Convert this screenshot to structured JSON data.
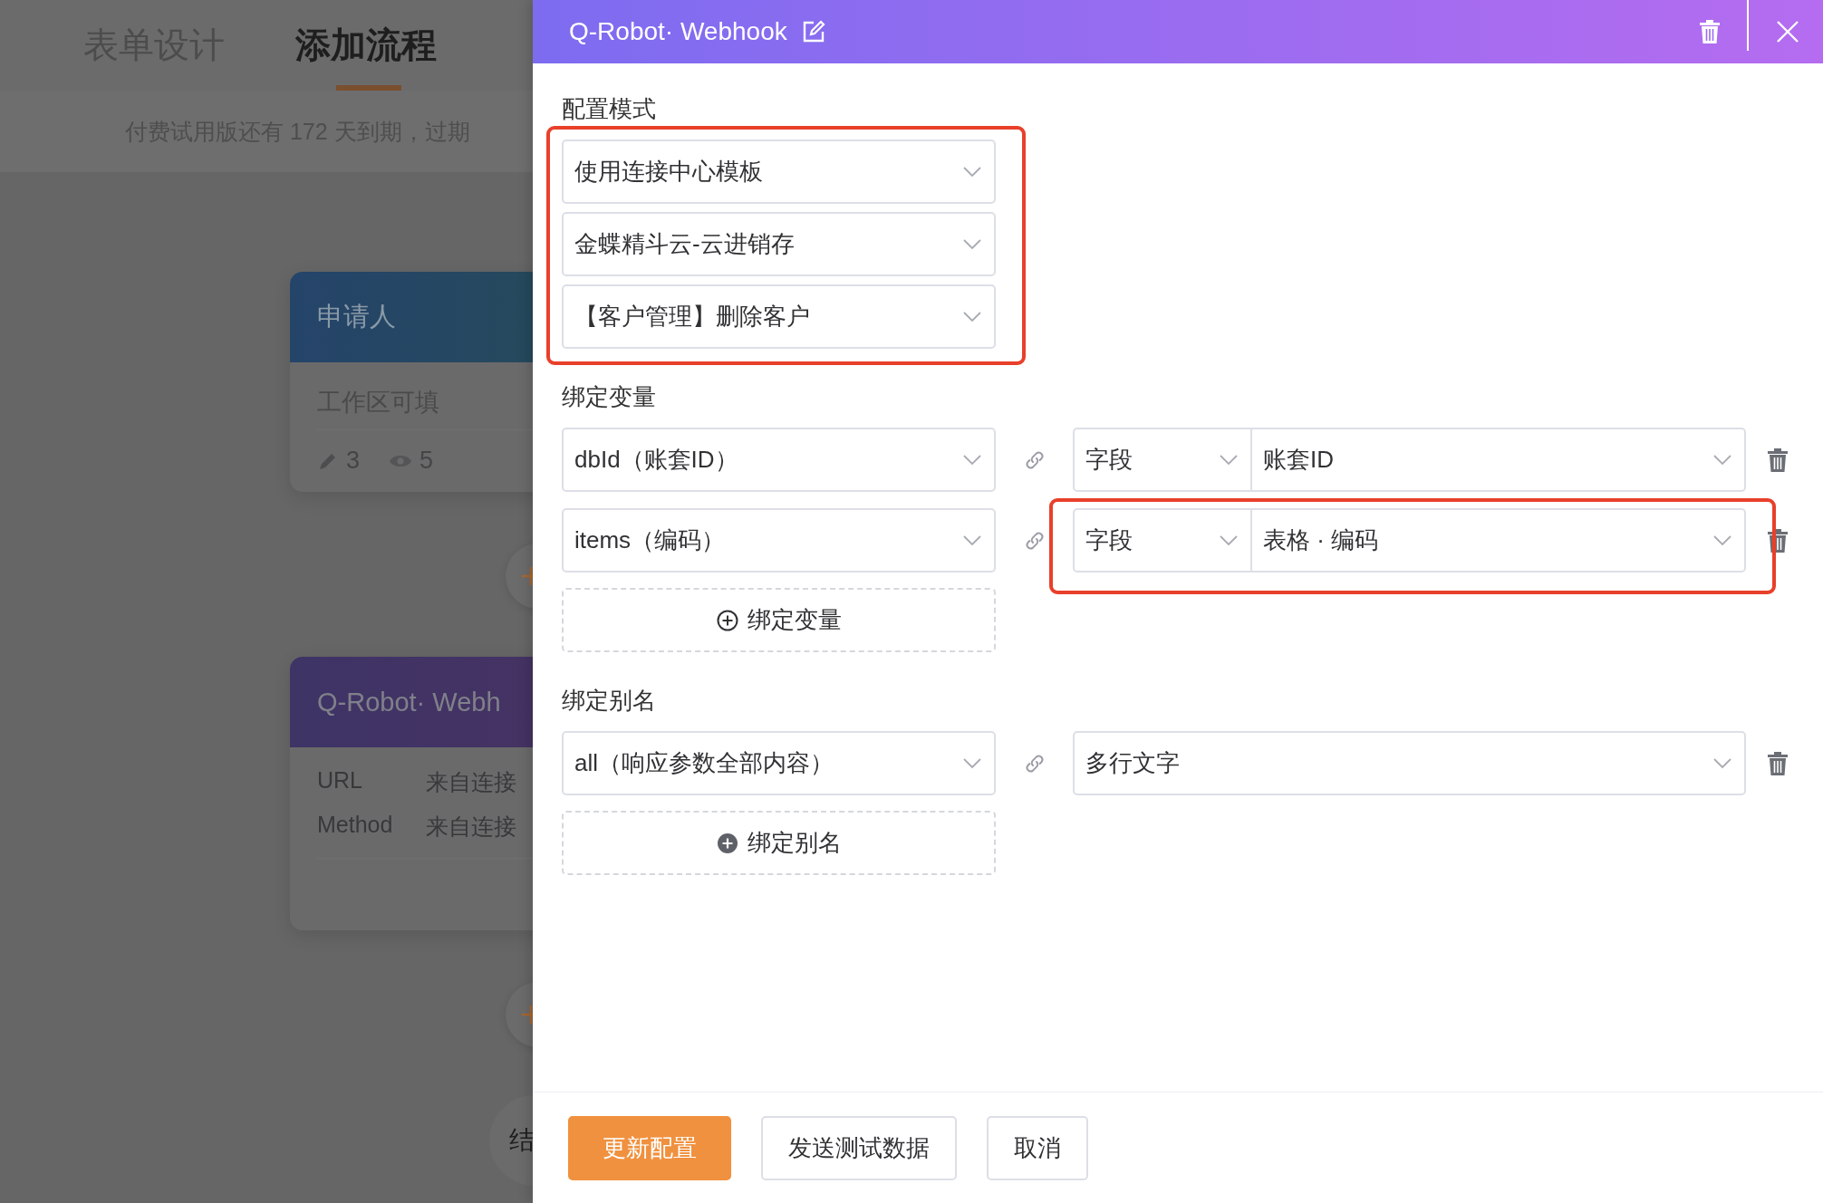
{
  "background": {
    "tabs": [
      {
        "label": "表单设计",
        "selected": false
      },
      {
        "label": "添加流程",
        "selected": true
      }
    ],
    "notice": "付费试用版还有 172 天到期，过期",
    "nodes": [
      {
        "kind": "applicant",
        "title": "申请人",
        "subtitle": "工作区可填",
        "edit_count": "3",
        "view_count": "5"
      },
      {
        "kind": "webhook",
        "title": "Q-Robot· Webh",
        "fields": [
          {
            "label": "URL",
            "value": "来自连接"
          },
          {
            "label": "Method",
            "value": "来自连接"
          }
        ]
      },
      {
        "kind": "end",
        "title": "结"
      }
    ]
  },
  "drawer": {
    "title": "Q-Robot· Webhook",
    "config": {
      "label": "配置模式",
      "highlighted": true,
      "selects": [
        "使用连接中心模板",
        "金蝶精斗云-云进销存",
        "【客户管理】删除客户"
      ]
    },
    "variables": {
      "label": "绑定变量",
      "rows": [
        {
          "source": "dbId（账套ID）",
          "type": "字段",
          "value": "账套ID",
          "highlighted": false
        },
        {
          "source": "items（编码）",
          "type": "字段",
          "value": "表格 · 编码",
          "highlighted": true
        }
      ],
      "add_button": {
        "label": "绑定变量",
        "kind": "outline"
      }
    },
    "aliases": {
      "label": "绑定别名",
      "rows": [
        {
          "source": "all（响应参数全部内容）",
          "value": "多行文字"
        }
      ],
      "add_button": {
        "label": "绑定别名",
        "kind": "filled"
      }
    },
    "buttons": [
      {
        "label": "更新配置",
        "kind": "primary"
      },
      {
        "label": "发送测试数据",
        "kind": "default"
      },
      {
        "label": "取消",
        "kind": "default"
      }
    ]
  }
}
